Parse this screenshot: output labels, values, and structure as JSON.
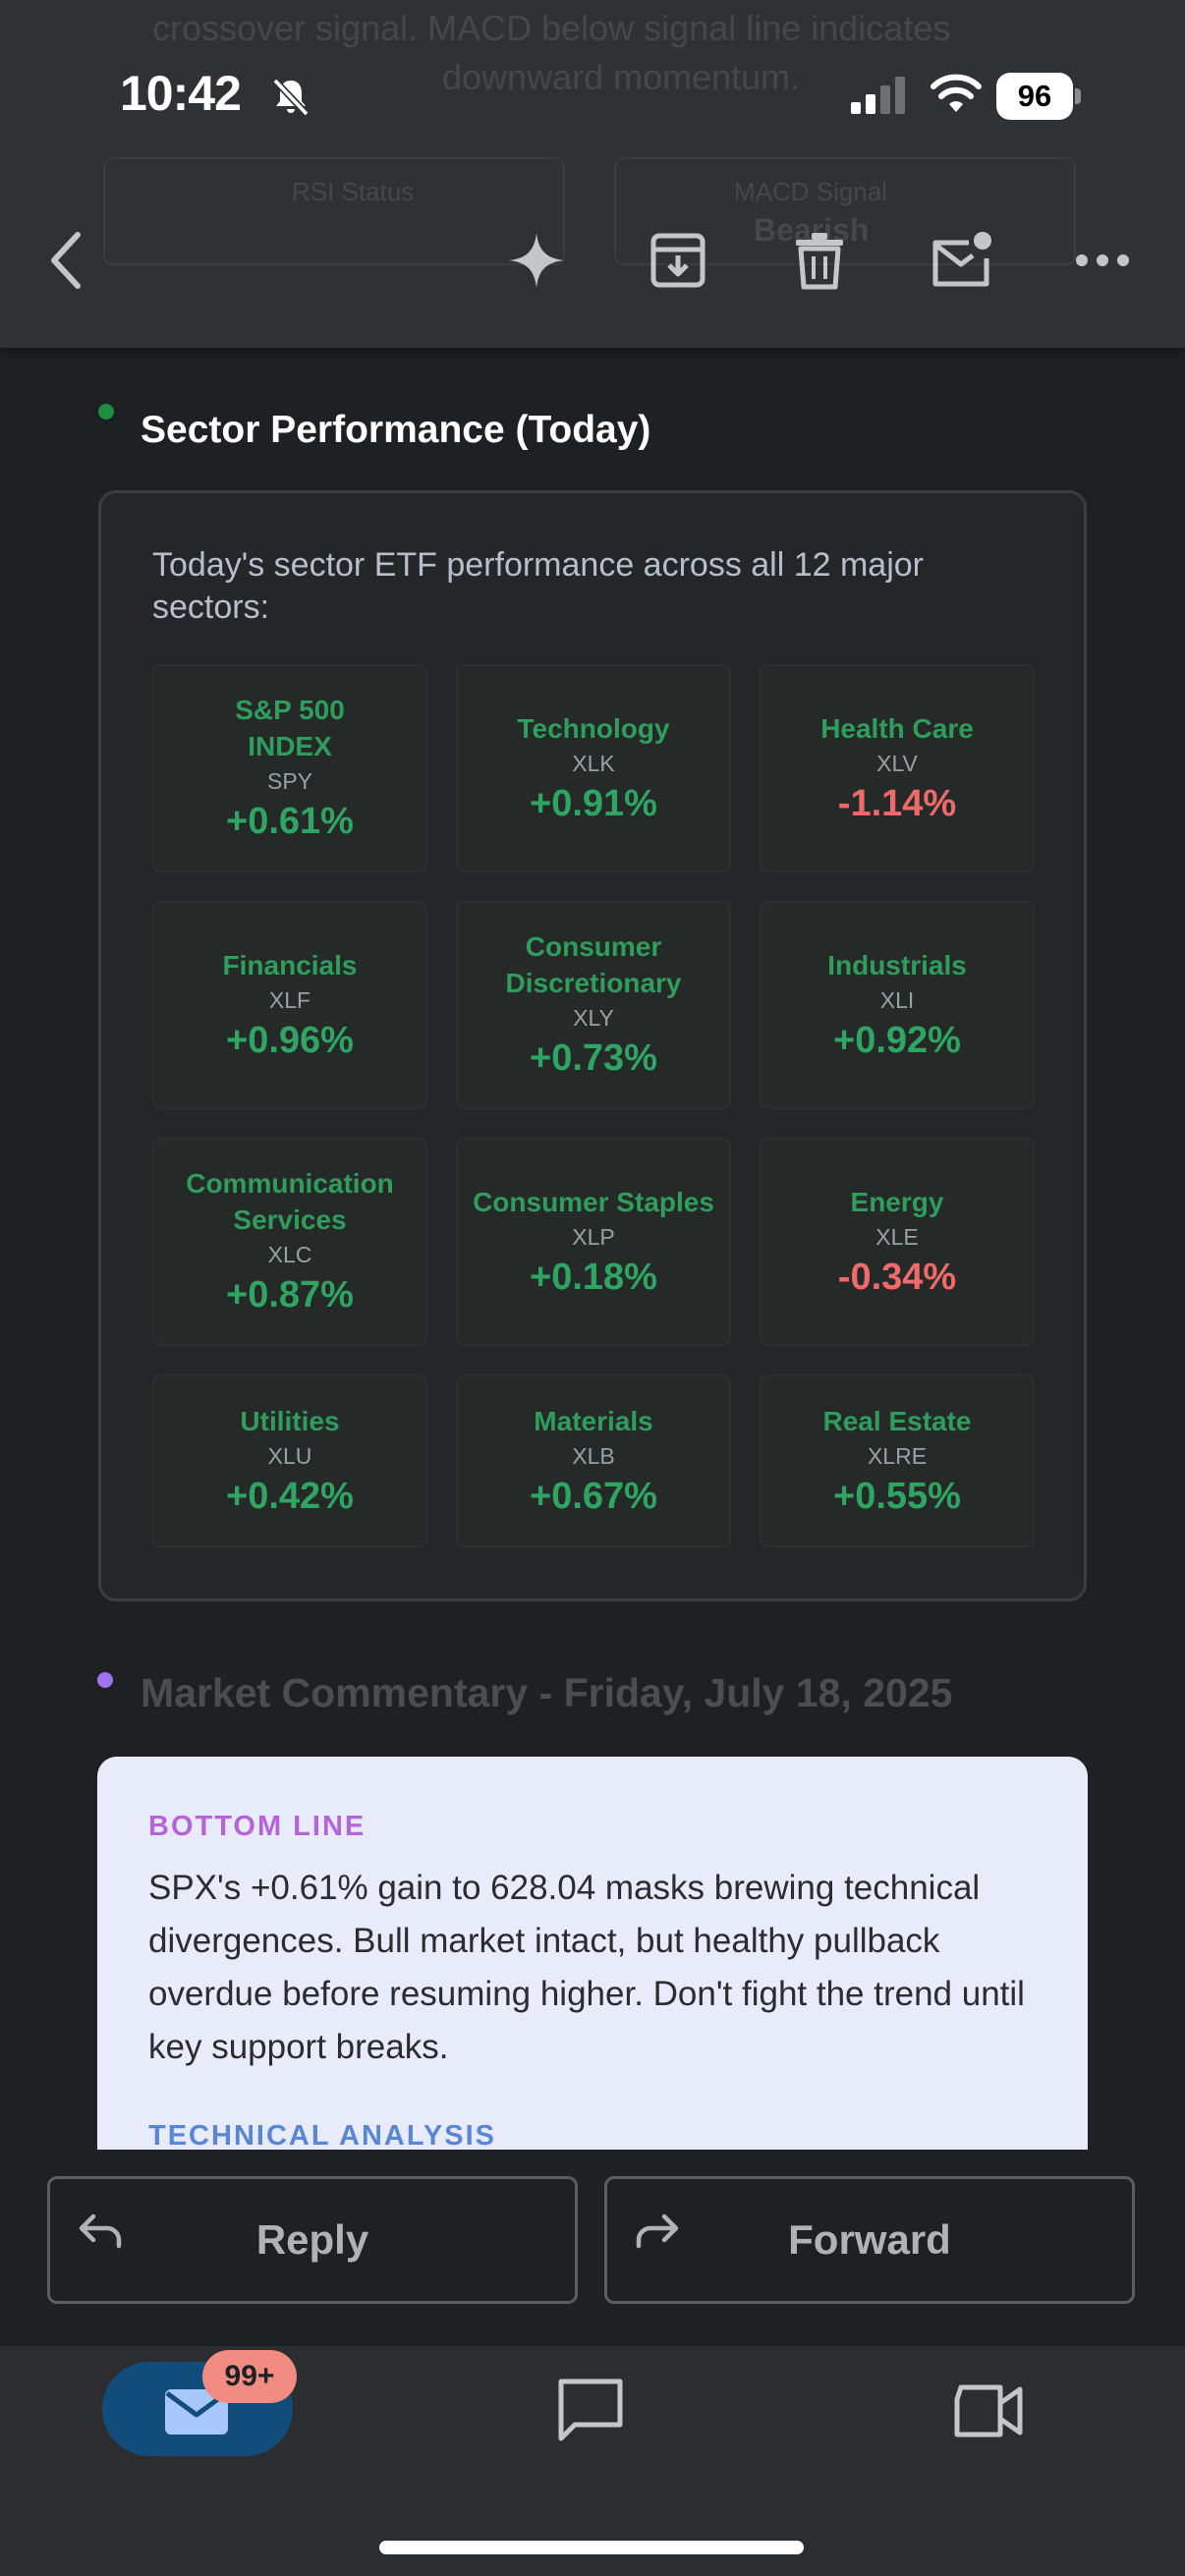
{
  "status_bar": {
    "time": "10:42",
    "battery": "96"
  },
  "background_ghost": {
    "line1": "crossover signal. MACD below signal line indicates",
    "line2": "downward momentum.",
    "card1_label": "RSI Status",
    "card2_label": "MACD Signal",
    "card2_value": "Bearish"
  },
  "toolbar": {
    "icons": [
      "back-icon",
      "sparkle-icon",
      "archive-icon",
      "trash-icon",
      "mark-unread-icon",
      "more-icon"
    ]
  },
  "sector_section": {
    "title": "Sector Performance (Today)",
    "dot_color": "#1e8e3e",
    "intro": "Today's sector ETF performance across all 12 major sectors:",
    "tiles": [
      {
        "name": "S&P 500 INDEX",
        "ticker": "SPY",
        "change": "+0.61%",
        "direction": "up"
      },
      {
        "name": "Technology",
        "ticker": "XLK",
        "change": "+0.91%",
        "direction": "up"
      },
      {
        "name": "Health Care",
        "ticker": "XLV",
        "change": "-1.14%",
        "direction": "down"
      },
      {
        "name": "Financials",
        "ticker": "XLF",
        "change": "+0.96%",
        "direction": "up"
      },
      {
        "name": "Consumer Discretionary",
        "ticker": "XLY",
        "change": "+0.73%",
        "direction": "up"
      },
      {
        "name": "Industrials",
        "ticker": "XLI",
        "change": "+0.92%",
        "direction": "up"
      },
      {
        "name": "Communication Services",
        "ticker": "XLC",
        "change": "+0.87%",
        "direction": "up"
      },
      {
        "name": "Consumer Staples",
        "ticker": "XLP",
        "change": "+0.18%",
        "direction": "up"
      },
      {
        "name": "Energy",
        "ticker": "XLE",
        "change": "-0.34%",
        "direction": "down"
      },
      {
        "name": "Utilities",
        "ticker": "XLU",
        "change": "+0.42%",
        "direction": "up"
      },
      {
        "name": "Materials",
        "ticker": "XLB",
        "change": "+0.67%",
        "direction": "up"
      },
      {
        "name": "Real Estate",
        "ticker": "XLRE",
        "change": "+0.55%",
        "direction": "up"
      }
    ]
  },
  "commentary": {
    "title": "Market Commentary - Friday, July 18, 2025",
    "dot_color": "#a173f2",
    "bottom_line_label": "BOTTOM LINE",
    "bottom_line_text": "SPX's +0.61% gain to 628.04 masks brewing technical divergences. Bull market intact, but healthy pullback overdue before resuming higher. Don't fight the trend until key support breaks.",
    "technical_label": "TECHNICAL ANALYSIS"
  },
  "actions": {
    "reply": "Reply",
    "forward": "Forward"
  },
  "bottom_nav": {
    "mail_badge": "99+",
    "items": [
      "mail-icon",
      "chat-icon",
      "video-icon"
    ]
  },
  "colors": {
    "up": "#2fa564",
    "down": "#ef6a6a",
    "tile_name": "#2f9d5c"
  }
}
